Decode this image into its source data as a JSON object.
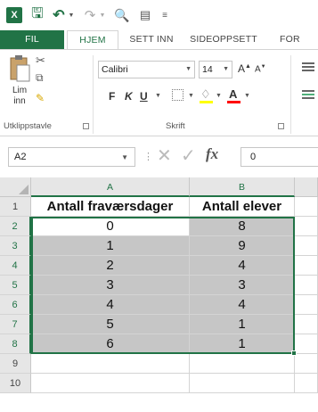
{
  "app": {
    "logo_letter": "X"
  },
  "qat": {
    "save_icon": "save-icon",
    "undo_icon": "undo-icon",
    "redo_icon": "redo-icon",
    "preview_icon": "print-preview-icon",
    "form_icon": "form-icon"
  },
  "tabs": {
    "file": "FIL",
    "home": "HJEM",
    "insert": "SETT INN",
    "layout": "SIDEOPPSETT",
    "formulas": "FOR"
  },
  "ribbon": {
    "paste_label": "Lim inn",
    "clipboard_group": "Utklippstavle",
    "font_group": "Skrift",
    "font_name": "Calibri",
    "font_size": "14",
    "bold": "F",
    "italic": "K",
    "underline": "U",
    "fill_color": "#ffff00",
    "font_color": "#ff0000"
  },
  "formula_bar": {
    "name_box": "A2",
    "value": "0"
  },
  "grid": {
    "columns": [
      "A",
      "B"
    ],
    "rows": [
      "1",
      "2",
      "3",
      "4",
      "5",
      "6",
      "7",
      "8",
      "9",
      "10"
    ],
    "header": [
      "Antall fraværsdager",
      "Antall elever"
    ],
    "data": [
      [
        "0",
        "8"
      ],
      [
        "1",
        "9"
      ],
      [
        "2",
        "4"
      ],
      [
        "3",
        "3"
      ],
      [
        "4",
        "4"
      ],
      [
        "5",
        "1"
      ],
      [
        "6",
        "1"
      ]
    ],
    "selection": "A2:B8",
    "accent_color": "#217346"
  }
}
